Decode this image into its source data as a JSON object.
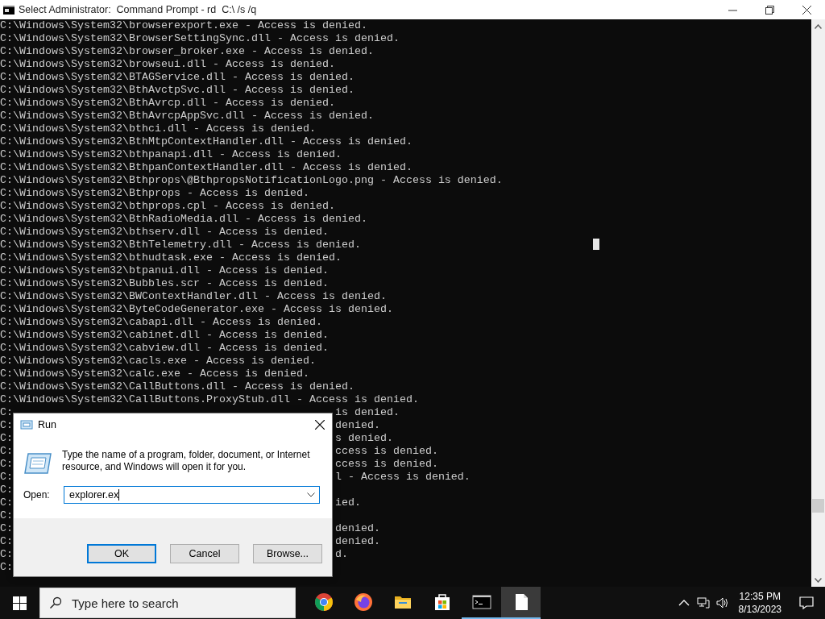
{
  "window": {
    "title": "Select Administrator:  Command Prompt - rd  C:\\ /s /q"
  },
  "console": {
    "lines": [
      {
        "text": "C:\\Windows\\System32\\browserexport.exe - Access is denied."
      },
      {
        "text": "C:\\Windows\\System32\\BrowserSettingSync.dll - Access is denied."
      },
      {
        "text": "C:\\Windows\\System32\\browser_broker.exe - Access is denied."
      },
      {
        "text": "C:\\Windows\\System32\\browseui.dll - Access is denied."
      },
      {
        "text": "C:\\Windows\\System32\\BTAGService.dll - Access is denied."
      },
      {
        "text": "C:\\Windows\\System32\\BthAvctpSvc.dll - Access is denied."
      },
      {
        "text": "C:\\Windows\\System32\\BthAvrcp.dll - Access is denied."
      },
      {
        "text": "C:\\Windows\\System32\\BthAvrcpAppSvc.dll - Access is denied."
      },
      {
        "text": "C:\\Windows\\System32\\bthci.dll - Access is denied."
      },
      {
        "text": "C:\\Windows\\System32\\BthMtpContextHandler.dll - Access is denied."
      },
      {
        "text": "C:\\Windows\\System32\\bthpanapi.dll - Access is denied."
      },
      {
        "text": "C:\\Windows\\System32\\BthpanContextHandler.dll - Access is denied."
      },
      {
        "text": "C:\\Windows\\System32\\Bthprops\\@BthpropsNotificationLogo.png - Access is denied."
      },
      {
        "text": "C:\\Windows\\System32\\Bthprops - Access is denied."
      },
      {
        "text": "C:\\Windows\\System32\\bthprops.cpl - Access is denied."
      },
      {
        "text": "C:\\Windows\\System32\\BthRadioMedia.dll - Access is denied."
      },
      {
        "text": "C:\\Windows\\System32\\bthserv.dll - Access is denied."
      },
      {
        "text": "C:\\Windows\\System32\\BthTelemetry.dll - Access is denied."
      },
      {
        "text": "C:\\Windows\\System32\\bthudtask.exe - Access is denied."
      },
      {
        "text": "C:\\Windows\\System32\\btpanui.dll - Access is denied."
      },
      {
        "text": "C:\\Windows\\System32\\Bubbles.scr - Access is denied."
      },
      {
        "text": "C:\\Windows\\System32\\BWContextHandler.dll - Access is denied."
      },
      {
        "text": "C:\\Windows\\System32\\ByteCodeGenerator.exe - Access is denied."
      },
      {
        "text": "C:\\Windows\\System32\\cabapi.dll - Access is denied."
      },
      {
        "text": "C:\\Windows\\System32\\cabinet.dll - Access is denied."
      },
      {
        "text": "C:\\Windows\\System32\\cabview.dll - Access is denied."
      },
      {
        "text": "C:\\Windows\\System32\\cacls.exe - Access is denied."
      },
      {
        "text": "C:\\Windows\\System32\\calc.exe - Access is denied."
      },
      {
        "text": "C:\\Windows\\System32\\CallButtons.dll - Access is denied."
      },
      {
        "text": "C:\\Windows\\System32\\CallButtons.ProxyStub.dll - Access is denied."
      },
      {
        "text": "C:",
        "end": "is denied."
      },
      {
        "text": "C:",
        "end": "denied."
      },
      {
        "text": "C:",
        "end": "s denied."
      },
      {
        "text": "C:",
        "end": "ccess is denied."
      },
      {
        "text": "C:",
        "end": "ccess is denied."
      },
      {
        "text": "C:",
        "end": "l - Access is denied."
      },
      {
        "text": "C:"
      },
      {
        "text": "C:",
        "end": "ied."
      },
      {
        "text": "C:"
      },
      {
        "text": "C:",
        "end": "denied."
      },
      {
        "text": "C:",
        "end": "denied."
      },
      {
        "text": "C:",
        "end": "d."
      },
      {
        "text": "C:"
      }
    ]
  },
  "run_dialog": {
    "title": "Run",
    "description": "Type the name of a program, folder, document, or Internet resource, and Windows will open it for you.",
    "open_label": "Open:",
    "value": "explorer.ex",
    "buttons": [
      {
        "label": "OK",
        "default": true
      },
      {
        "label": "Cancel",
        "default": false
      },
      {
        "label": "Browse...",
        "default": false
      }
    ]
  },
  "taskbar": {
    "search": {
      "placeholder": "Type here to search"
    },
    "apps": [
      {
        "kind": "chrome",
        "running": false,
        "selected": false
      },
      {
        "kind": "firefox",
        "running": false,
        "selected": false
      },
      {
        "kind": "folder",
        "running": false,
        "selected": false
      },
      {
        "kind": "store",
        "running": false,
        "selected": false
      },
      {
        "kind": "terminal",
        "running": true,
        "selected": false
      },
      {
        "kind": "document",
        "running": true,
        "selected": true
      }
    ],
    "time": "12:35 PM",
    "date": "8/13/2023"
  }
}
